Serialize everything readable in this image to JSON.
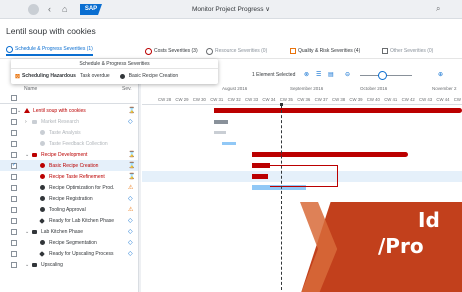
{
  "shell": {
    "title": "Monitor Project Progress ∨",
    "logo": "SAP",
    "nav_back": "‹",
    "nav_home": "⌂",
    "search_icon": "⌕"
  },
  "object": {
    "title": "Lentil soup with cookies"
  },
  "categories": [
    {
      "label": "Schedule & Progress Severities (1)",
      "color": "#0a6ed1"
    },
    {
      "label": "Costs Severities (3)",
      "color": "#bb0000"
    },
    {
      "label": "Resource Severities (0)",
      "color": "#6a6d70"
    },
    {
      "label": "Quality & Risk Severities (4)",
      "color": "#e9730c"
    },
    {
      "label": "Other Severities (0)",
      "color": "#6a6d70"
    }
  ],
  "popover": {
    "header": "Schedule & Progress Severities",
    "item_label": "Scheduling Hazardous",
    "item_detail": "Task overdue",
    "item_target": "Basic Recipe Creation"
  },
  "toolbar": {
    "selection": "1 Element Selected",
    "icons": [
      "⊗",
      "☰",
      "▤",
      "⊖",
      "⊕"
    ]
  },
  "columns": {
    "name": "Name",
    "severity": "Sev."
  },
  "tree": [
    {
      "label": "Lentil soup with cookies",
      "type": "phase-red",
      "level": 0,
      "sev": "⌛",
      "sevc": "red",
      "expanded": true,
      "dim": false
    },
    {
      "label": "Market Research",
      "type": "phase-grey",
      "level": 1,
      "sev": "◇",
      "sevc": "blue",
      "expanded": false,
      "dim": true
    },
    {
      "label": "Taste Analysis",
      "type": "dot-grey",
      "level": 2,
      "sev": "",
      "sevc": "blue",
      "dim": true
    },
    {
      "label": "Taste Feedback Collection",
      "type": "dot-grey",
      "level": 2,
      "sev": "",
      "sevc": "blue",
      "dim": true
    },
    {
      "label": "Recipe Development",
      "type": "phase-red",
      "level": 1,
      "sev": "⌛",
      "sevc": "red",
      "expanded": true,
      "dim": false
    },
    {
      "label": "Basic Recipe Creation",
      "type": "dot-red",
      "level": 2,
      "sev": "⌛",
      "sevc": "red",
      "selected": true,
      "dim": false
    },
    {
      "label": "Recipe Taste Refinement",
      "type": "dot-red",
      "level": 2,
      "sev": "⌛",
      "sevc": "red",
      "dim": false
    },
    {
      "label": "Recipe Optimization for Prod.",
      "type": "dot-dark",
      "level": 2,
      "sev": "⚠",
      "sevc": "orange",
      "dim": false
    },
    {
      "label": "Recipe Registration",
      "type": "dot-dark",
      "level": 2,
      "sev": "◇",
      "sevc": "blue",
      "dim": false
    },
    {
      "label": "Tooling Approval",
      "type": "dot-dark",
      "level": 2,
      "sev": "⚠",
      "sevc": "orange",
      "dim": false
    },
    {
      "label": "Ready for Lab Kitchen Phase",
      "type": "diamond",
      "level": 2,
      "sev": "◇",
      "sevc": "blue",
      "dim": false
    },
    {
      "label": "Lab Kitchen Phase",
      "type": "phase-dark",
      "level": 1,
      "sev": "◇",
      "sevc": "blue",
      "expanded": true,
      "dim": false
    },
    {
      "label": "Recipe Segmentation",
      "type": "dot-dark",
      "level": 2,
      "sev": "◇",
      "sevc": "blue",
      "dim": false
    },
    {
      "label": "Ready for Upscaling Process",
      "type": "diamond",
      "level": 2,
      "sev": "◇",
      "sevc": "blue",
      "dim": false
    },
    {
      "label": "Upscaling",
      "type": "phase-dark",
      "level": 1,
      "sev": "",
      "sevc": "blue",
      "expanded": true,
      "dim": false
    }
  ],
  "timeline": {
    "months": [
      "August 2016",
      "September 2016",
      "October 2016",
      "November 2"
    ],
    "weeks": [
      "CW 28",
      "CW 29",
      "CW 30",
      "CW 31",
      "CW 32",
      "CW 33",
      "CW 34",
      "CW 35",
      "CW 36",
      "CW 37",
      "CW 38",
      "CW 39",
      "CW 40",
      "CW 41",
      "CW 42",
      "CW 43",
      "CW 44",
      "CW 45"
    ]
  },
  "banner": {
    "line1": "Id",
    "line2": "/Pro"
  }
}
